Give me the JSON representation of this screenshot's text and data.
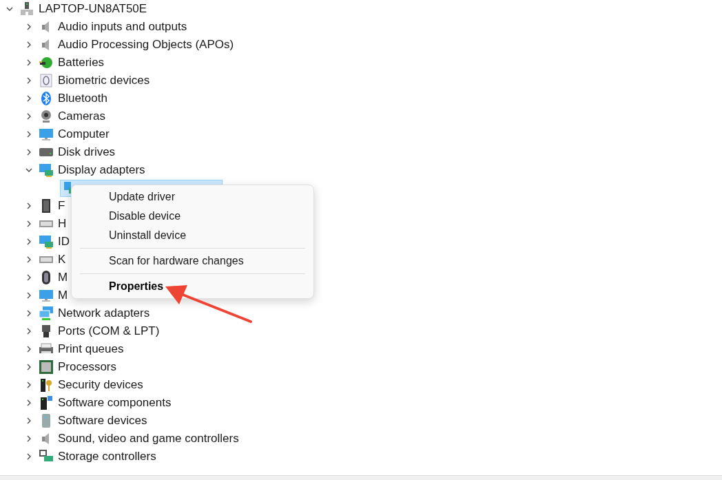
{
  "tree": [
    {
      "label": "LAPTOP-UN8AT50E",
      "expanded": true,
      "children": [
        {
          "label": "Audio inputs and outputs",
          "expanded": false
        },
        {
          "label": "Audio Processing Objects (APOs)",
          "expanded": false
        },
        {
          "label": "Batteries",
          "expanded": false
        },
        {
          "label": "Biometric devices",
          "expanded": false
        },
        {
          "label": "Bluetooth",
          "expanded": false
        },
        {
          "label": "Cameras",
          "expanded": false
        },
        {
          "label": "Computer",
          "expanded": false
        },
        {
          "label": "Disk drives",
          "expanded": false
        },
        {
          "label": "Display adapters",
          "expanded": true,
          "children": [
            {
              "selected": true
            }
          ]
        },
        {
          "label": "F",
          "expanded": false
        },
        {
          "label": "H",
          "expanded": false
        },
        {
          "label": "ID",
          "expanded": false
        },
        {
          "label": "K",
          "expanded": false
        },
        {
          "label": "M",
          "expanded": false
        },
        {
          "label": "M",
          "expanded": false
        },
        {
          "label": "Network adapters",
          "expanded": false
        },
        {
          "label": "Ports (COM & LPT)",
          "expanded": false
        },
        {
          "label": "Print queues",
          "expanded": false
        },
        {
          "label": "Processors",
          "expanded": false
        },
        {
          "label": "Security devices",
          "expanded": false
        },
        {
          "label": "Software components",
          "expanded": false
        },
        {
          "label": "Software devices",
          "expanded": false
        },
        {
          "label": "Sound, video and game controllers",
          "expanded": false
        },
        {
          "label": "Storage controllers",
          "expanded": false
        }
      ]
    }
  ],
  "context_menu": {
    "groups": [
      [
        {
          "label": "Update driver",
          "default": false
        },
        {
          "label": "Disable device",
          "default": false
        },
        {
          "label": "Uninstall device",
          "default": false
        }
      ],
      [
        {
          "label": "Scan for hardware changes",
          "default": false
        }
      ],
      [
        {
          "label": "Properties",
          "default": true
        }
      ]
    ]
  }
}
